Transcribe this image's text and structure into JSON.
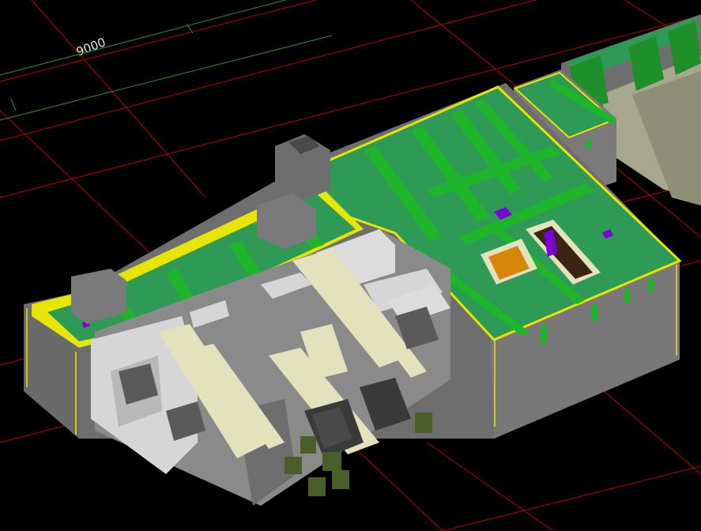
{
  "viewport": {
    "background": "#000000",
    "dimension_label": "9000",
    "colors": {
      "grid_red": "#b00000",
      "grid_green": "#3a8a3a",
      "floor_green": "#2e9a55",
      "beam_green": "#1fb52a",
      "outline_yellow": "#e6e600",
      "wall_grey": "#6e6e6e",
      "dark_grey": "#4a4a4a",
      "light_grey": "#d6d6d6",
      "cream": "#e2e2bd",
      "olive": "#4a5e2a",
      "purple": "#7b00d6",
      "orange": "#d8860a",
      "brown": "#3b2412"
    }
  }
}
